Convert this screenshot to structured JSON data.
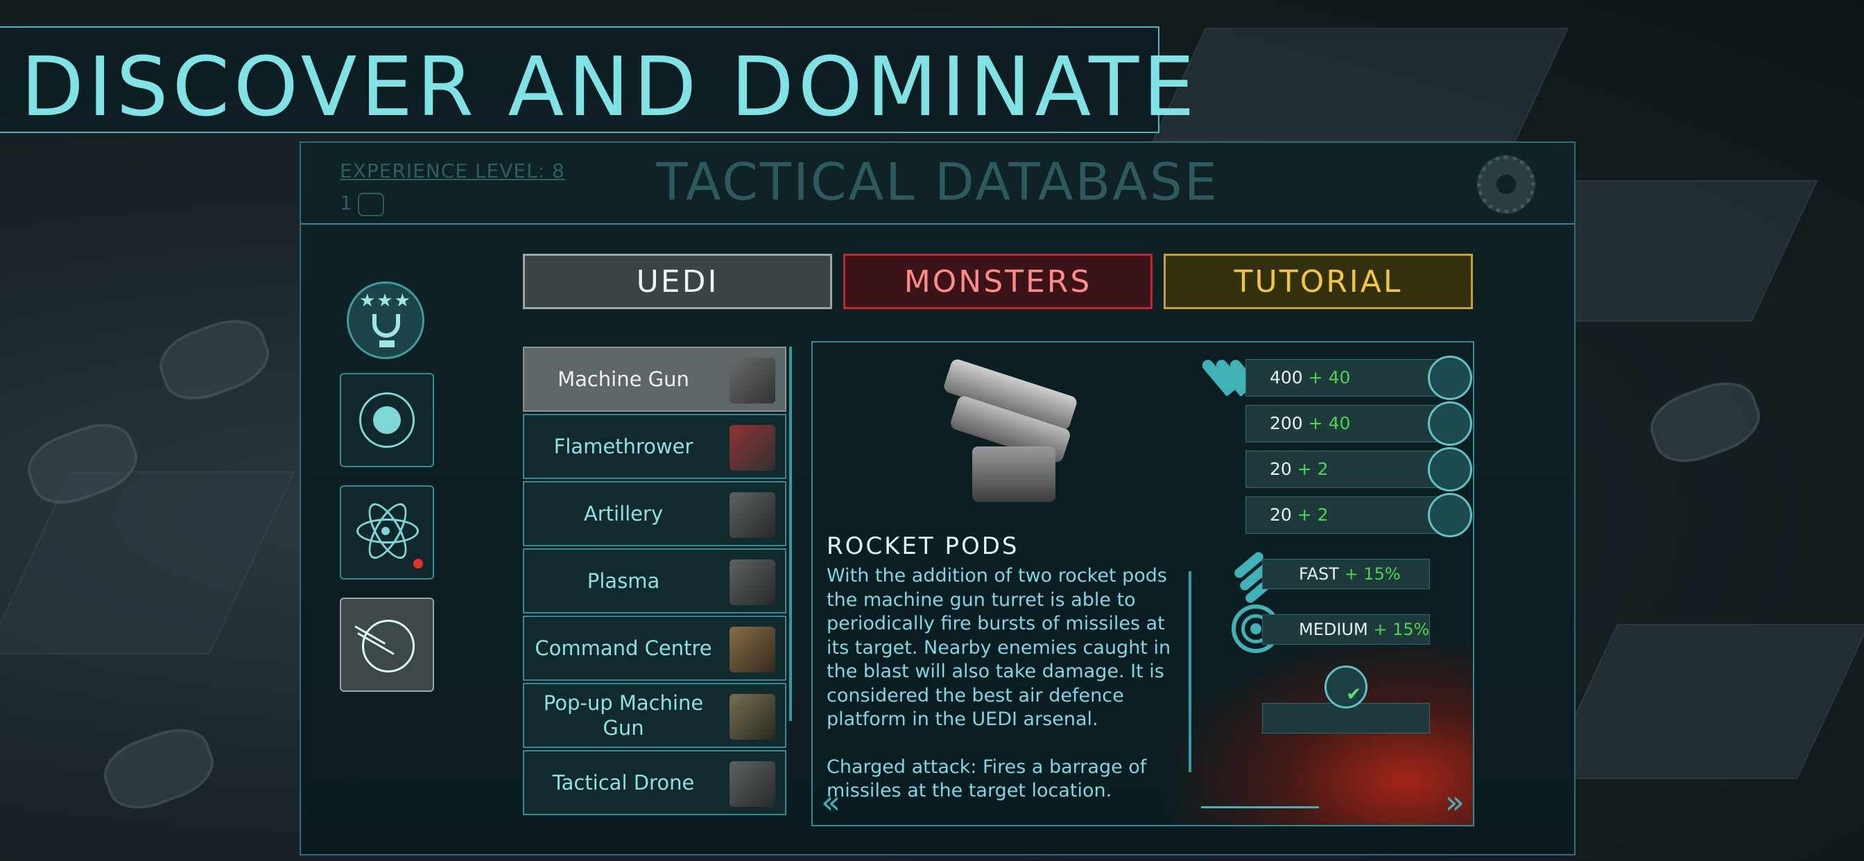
{
  "headline": "DISCOVER AND DOMINATE",
  "header": {
    "experience_label": "EXPERIENCE LEVEL: 8",
    "currency_value": "1",
    "title": "TACTICAL DATABASE",
    "settings_icon": "gear-icon"
  },
  "rail": {
    "items": [
      {
        "icon": "trophy-icon"
      },
      {
        "icon": "planet-icon"
      },
      {
        "icon": "atom-icon",
        "notification": true
      },
      {
        "icon": "radar-icon",
        "selected": true
      }
    ]
  },
  "tabs": [
    {
      "label": "UEDI",
      "color": "#9aa5a8",
      "selected": true
    },
    {
      "label": "MONSTERS",
      "color": "#c2272e"
    },
    {
      "label": "TUTORIAL",
      "color": "#c9a21f"
    }
  ],
  "list": [
    {
      "label": "Machine Gun",
      "selected": true
    },
    {
      "label": "Flamethrower"
    },
    {
      "label": "Artillery"
    },
    {
      "label": "Plasma"
    },
    {
      "label": "Command Centre"
    },
    {
      "label": "Pop-up Machine Gun"
    },
    {
      "label": "Tactical Drone"
    }
  ],
  "detail": {
    "title": "ROCKET PODS",
    "description": "With the addition of two rocket pods the machine gun turret is able to periodically fire bursts of missiles at its target. Nearby enemies caught in the blast will also take damage. It is considered the best air defence platform in the UEDI arsenal.",
    "charged": "Charged attack: Fires a barrage of missiles at the target location.",
    "stats": [
      {
        "value": "400",
        "bonus": "+ 40",
        "icon": "soldier-icon"
      },
      {
        "value": "200",
        "bonus": "+ 40",
        "icon": "spider-icon"
      },
      {
        "value": "20",
        "bonus": "+ 2",
        "icon": "beast-icon"
      },
      {
        "value": "20",
        "bonus": "+ 2",
        "icon": "brute-icon"
      }
    ],
    "speed": {
      "label": "FAST",
      "bonus": "+ 15%"
    },
    "range": {
      "label": "MEDIUM",
      "bonus": "+ 15%"
    },
    "nav_prev": "«",
    "nav_next": "»"
  }
}
